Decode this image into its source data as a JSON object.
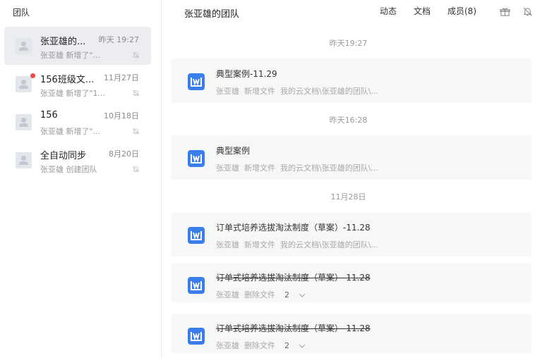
{
  "sidebar": {
    "title": "团队",
    "teams": [
      {
        "name": "张亚雄的...",
        "time": "昨天 19:27",
        "sub": "张亚雄 新增了\"...",
        "active": true,
        "unread": false
      },
      {
        "name": "156班级文...",
        "time": "11月27日",
        "sub": "张亚雄 新增了\"1...",
        "active": false,
        "unread": true
      },
      {
        "name": "156",
        "time": "10月18日",
        "sub": "张亚雄 新增了\"...",
        "active": false,
        "unread": false
      },
      {
        "name": "全自动同步",
        "time": "8月20日",
        "sub": "张亚雄 创建团队",
        "active": false,
        "unread": false
      }
    ]
  },
  "main": {
    "title": "张亚雄的团队",
    "tabs": [
      {
        "label": "动态",
        "active": true
      },
      {
        "label": "文档",
        "active": false
      },
      {
        "label": "成员(8)",
        "active": false
      }
    ],
    "header_icons": [
      "gift-icon",
      "bell-muted-icon"
    ],
    "feed": [
      {
        "date": "昨天19:27",
        "items": [
          {
            "title": "典型案例-11.29",
            "user": "张亚雄",
            "action": "新增文件",
            "path": "我的云文档\\张亚雄的团队\\...",
            "deleted": false
          }
        ]
      },
      {
        "date": "昨天16:28",
        "items": [
          {
            "title": "典型案例",
            "user": "张亚雄",
            "action": "新增文件",
            "path": "我的云文档\\张亚雄的团队\\...",
            "deleted": false
          }
        ]
      },
      {
        "date": "11月28日",
        "items": [
          {
            "title": "订单式培养选拔淘汰制度（草案）-11.28",
            "user": "张亚雄",
            "action": "新增文件",
            "path": "我的云文档\\张亚雄的团队\\...",
            "deleted": false
          },
          {
            "title": "订单式培养选拔淘汰制度（草案）-11.28",
            "user": "张亚雄",
            "action": "删除文件",
            "count": "2",
            "deleted": true
          },
          {
            "title": "订单式培养选拔淘汰制度（草案）-11.28",
            "user": "张亚雄",
            "action": "删除文件",
            "count": "2",
            "deleted": true
          }
        ]
      }
    ]
  },
  "colors": {
    "accent": "#3a78dd",
    "doc_icon": "#3a7eeb",
    "unread_dot": "#f04a4a",
    "active_item": "#ebedf0"
  }
}
